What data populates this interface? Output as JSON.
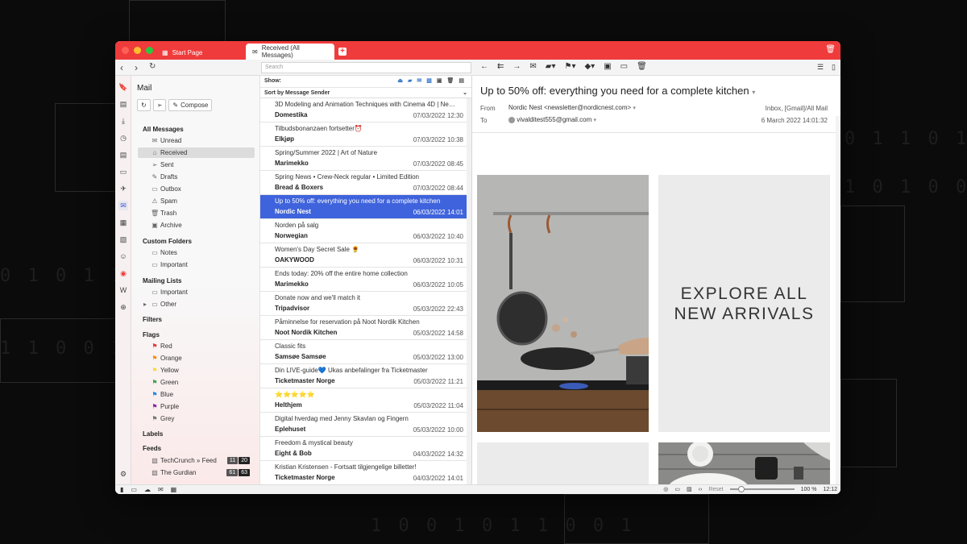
{
  "tabs": {
    "start_page": "Start Page",
    "received": "Received (All Messages)"
  },
  "toolbar": {
    "search_placeholder": "Search"
  },
  "mail_panel": {
    "title": "Mail",
    "compose_label": "Compose",
    "sections": {
      "all_messages": "All Messages",
      "custom_folders": "Custom Folders",
      "mailing_lists": "Mailing Lists",
      "filters": "Filters",
      "flags": "Flags",
      "labels": "Labels",
      "feeds": "Feeds"
    },
    "folders": [
      "Unread",
      "Received",
      "Sent",
      "Drafts",
      "Outbox",
      "Spam",
      "Trash",
      "Archive"
    ],
    "custom_folders": [
      "Notes",
      "Important"
    ],
    "mailing_lists": [
      "Important",
      "Other"
    ],
    "flags": [
      {
        "label": "Red",
        "color": "#e53935"
      },
      {
        "label": "Orange",
        "color": "#fb8c00"
      },
      {
        "label": "Yellow",
        "color": "#fdd835"
      },
      {
        "label": "Green",
        "color": "#43a047"
      },
      {
        "label": "Blue",
        "color": "#1e88e5"
      },
      {
        "label": "Purple",
        "color": "#8e24aa"
      },
      {
        "label": "Grey",
        "color": "#757575"
      }
    ],
    "feeds": [
      {
        "label": "TechCrunch » Feed",
        "unread": "11",
        "total": "20"
      },
      {
        "label": "The Gurdian",
        "unread": "61",
        "total": "63"
      }
    ]
  },
  "message_list": {
    "show_label": "Show:",
    "sort_label": "Sort by Message Sender",
    "messages": [
      {
        "subject": "3D Modeling and Animation Techniques with Cinema 4D | Ne…",
        "sender": "Domestika",
        "date": "07/03/2022 12:30"
      },
      {
        "subject": "Tilbudsbonanzaen fortsetter⏰",
        "sender": "Elkjøp",
        "date": "07/03/2022 10:38"
      },
      {
        "subject": "Spring/Summer 2022 | Art of Nature",
        "sender": "Marimekko",
        "date": "07/03/2022 08:45"
      },
      {
        "subject": "Spring News • Crew-Neck regular • Limited Edition",
        "sender": "Bread & Boxers",
        "date": "07/03/2022 08:44"
      },
      {
        "subject": "Up to 50% off: everything you need for a complete kitchen",
        "sender": "Nordic Nest",
        "date": "06/03/2022 14:01"
      },
      {
        "subject": "Norden på salg",
        "sender": "Norwegian",
        "date": "06/03/2022 10:40"
      },
      {
        "subject": "Women's Day Secret Sale 🌻",
        "sender": "OAKYWOOD",
        "date": "06/03/2022 10:31"
      },
      {
        "subject": "Ends today: 20% off the entire home collection",
        "sender": "Marimekko",
        "date": "06/03/2022 10:05"
      },
      {
        "subject": "Donate now and we'll match it",
        "sender": "Tripadvisor",
        "date": "05/03/2022 22:43"
      },
      {
        "subject": "Påminnelse for reservation på Noot Nordik Kitchen",
        "sender": "Noot Nordik Kitchen",
        "date": "05/03/2022 14:58"
      },
      {
        "subject": "Classic fits",
        "sender": "Samsøe Samsøe",
        "date": "05/03/2022 13:00"
      },
      {
        "subject": "Din LIVE-guide💙 Ukas anbefalinger fra Ticketmaster",
        "sender": "Ticketmaster Norge",
        "date": "05/03/2022 11:21"
      },
      {
        "subject": "⭐⭐⭐⭐⭐",
        "sender": "Helthjem",
        "date": "05/03/2022 11:04"
      },
      {
        "subject": "Digital hverdag med Jenny Skavlan og Fingern",
        "sender": "Eplehuset",
        "date": "05/03/2022 10:00"
      },
      {
        "subject": "Freedom & mystical beauty",
        "sender": "Eight & Bob",
        "date": "04/03/2022 14:32"
      },
      {
        "subject": "Kristian Kristensen - Fortsatt tilgjengelige billetter!",
        "sender": "Ticketmaster Norge",
        "date": "04/03/2022 14:01"
      }
    ]
  },
  "reader": {
    "subject": "Up to 50% off: everything you need for a complete kitchen",
    "from_label": "From",
    "from_value": "Nordic Nest <newsletter@nordicnest.com>",
    "to_label": "To",
    "to_value": "vivalditest555@gmail.com",
    "folder": "Inbox, [Gmail]/All Mail",
    "date": "6 March 2022 14:01:32",
    "banner_line1": "EXPLORE ALL",
    "banner_line2": "NEW ARRIVALS"
  },
  "status": {
    "reset_label": "Reset",
    "zoom": "100 %",
    "zoom_level": 1.0,
    "time": "12:12"
  },
  "colors": {
    "accent": "#ef3b3b",
    "selection": "#3f63dc"
  }
}
